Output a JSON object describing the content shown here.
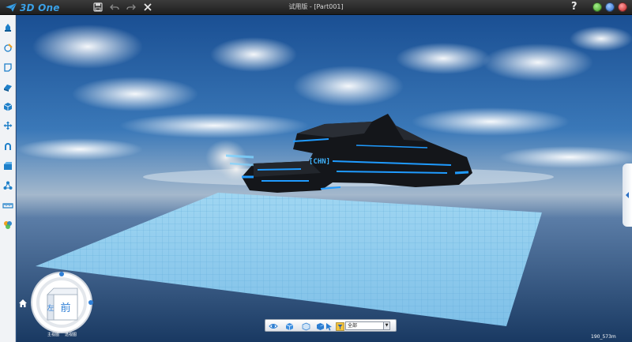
{
  "app": {
    "logo_text": "3D One",
    "window_title": "试用版 - [Part001]",
    "help_label": "?"
  },
  "quick_access": [
    {
      "icon": "save-icon"
    },
    {
      "icon": "undo-icon"
    },
    {
      "icon": "redo-icon"
    },
    {
      "icon": "close-x-icon"
    }
  ],
  "left_toolbar": [
    {
      "icon": "basic-solid-icon"
    },
    {
      "icon": "sketch-icon"
    },
    {
      "icon": "sketch-edit-icon"
    },
    {
      "icon": "feature-icon"
    },
    {
      "icon": "combine-icon"
    },
    {
      "icon": "move-icon"
    },
    {
      "icon": "magnet-icon"
    },
    {
      "icon": "component-icon"
    },
    {
      "icon": "pattern-icon"
    },
    {
      "icon": "measure-icon"
    },
    {
      "icon": "render-icon"
    }
  ],
  "viewport": {
    "model_label": "[CHN]",
    "view_cube": {
      "face_label": "前",
      "side_label": "左",
      "bottom_labels": [
        "主视图",
        "透视图"
      ]
    },
    "coordinate_readout": "190_573m"
  },
  "bottom_toolbar": {
    "icons": [
      "view-eye-icon",
      "solid-view-icon",
      "box-view-icon",
      "cube-view-icon",
      "cursor-select-icon",
      "filter-icon"
    ],
    "filter_select_value": "全部"
  },
  "colors": {
    "brand_blue": "#3aa0e6",
    "titlebar": "#2a2a2a",
    "grid_blue": "#8fd0ef",
    "ship_accent": "#1f9bff"
  }
}
